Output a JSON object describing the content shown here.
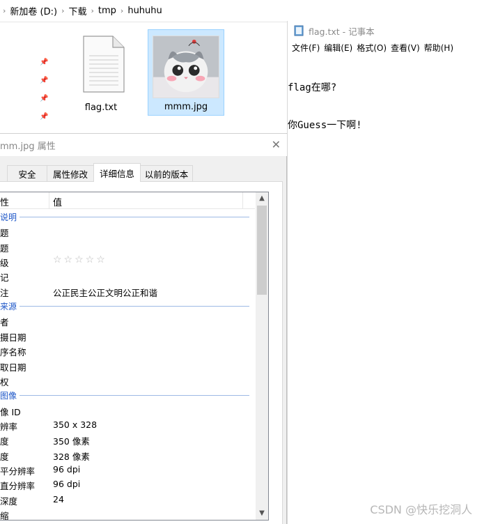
{
  "explorer": {
    "breadcrumb": [
      "新加卷 (D:)",
      "下载",
      "tmp",
      "huhuhu"
    ],
    "files": [
      {
        "name": "flag.txt",
        "type": "text-file-icon",
        "selected": false
      },
      {
        "name": "mmm.jpg",
        "type": "image-thumbnail",
        "selected": true
      }
    ]
  },
  "properties": {
    "title": "mm.jpg 属性",
    "tabs": [
      "安全",
      "属性修改",
      "详细信息",
      "以前的版本"
    ],
    "active_tab": "详细信息",
    "col_property": "性",
    "col_value": "值",
    "rows": [
      {
        "kind": "group",
        "label": "说明"
      },
      {
        "kind": "row",
        "key": "题",
        "value": ""
      },
      {
        "kind": "row",
        "key": "题",
        "value": ""
      },
      {
        "kind": "row",
        "key": "级",
        "value": "☆☆☆☆☆",
        "rating": 0
      },
      {
        "kind": "row",
        "key": "记",
        "value": ""
      },
      {
        "kind": "row",
        "key": "注",
        "value": "公正民主公正文明公正和谐"
      },
      {
        "kind": "group",
        "label": "来源"
      },
      {
        "kind": "row",
        "key": "者",
        "value": ""
      },
      {
        "kind": "row",
        "key": "摄日期",
        "value": ""
      },
      {
        "kind": "row",
        "key": "序名称",
        "value": ""
      },
      {
        "kind": "row",
        "key": "取日期",
        "value": ""
      },
      {
        "kind": "row",
        "key": "权",
        "value": ""
      },
      {
        "kind": "group",
        "label": "图像"
      },
      {
        "kind": "row",
        "key": "像 ID",
        "value": ""
      },
      {
        "kind": "row",
        "key": "辨率",
        "value": "350 x 328"
      },
      {
        "kind": "row",
        "key": "度",
        "value": "350 像素"
      },
      {
        "kind": "row",
        "key": "度",
        "value": "328 像素"
      },
      {
        "kind": "row",
        "key": "平分辨率",
        "value": "96 dpi"
      },
      {
        "kind": "row",
        "key": "直分辨率",
        "value": "96 dpi"
      },
      {
        "kind": "row",
        "key": "深度",
        "value": "24"
      },
      {
        "kind": "row",
        "key": "缩",
        "value": ""
      }
    ]
  },
  "notepad": {
    "title": "flag.txt - 记事本",
    "menu": [
      "文件(F)",
      "编辑(E)",
      "格式(O)",
      "查看(V)",
      "帮助(H)"
    ],
    "lines": [
      "flag在哪?",
      "你Guess一下啊!"
    ]
  },
  "watermark": "CSDN @快乐挖洞人"
}
